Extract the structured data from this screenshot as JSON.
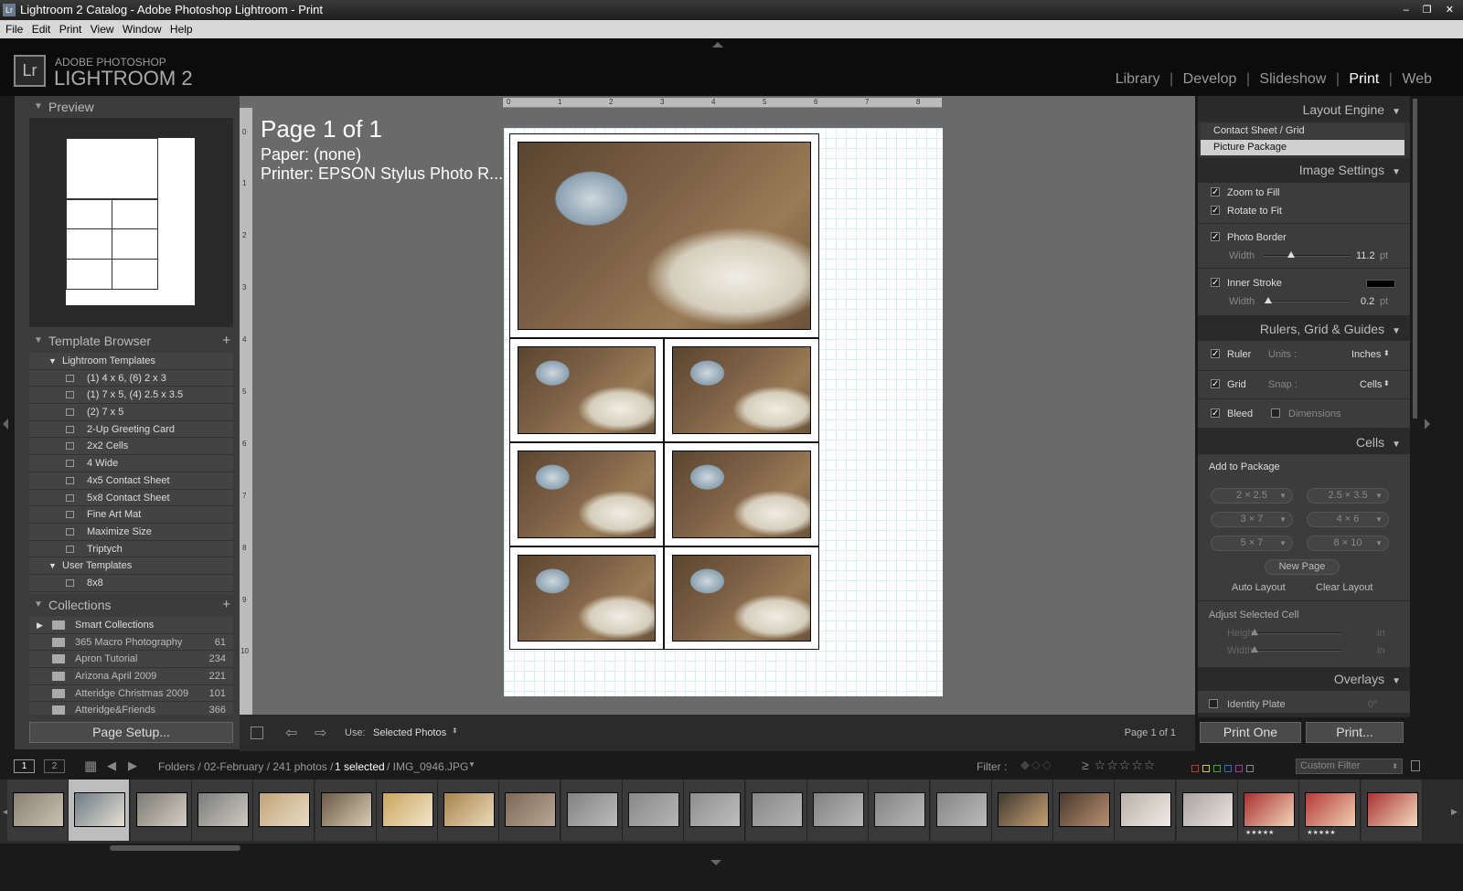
{
  "window": {
    "title": "Lightroom 2 Catalog - Adobe Photoshop Lightroom - Print",
    "app_icon": "Lr",
    "controls": "– ❐ ✕"
  },
  "menu": [
    "File",
    "Edit",
    "Print",
    "View",
    "Window",
    "Help"
  ],
  "identity": {
    "logo": "Lr",
    "brand_top": "ADOBE PHOTOSHOP",
    "brand_main": "LIGHTROOM 2"
  },
  "modules": [
    "Library",
    "Develop",
    "Slideshow",
    "Print",
    "Web"
  ],
  "left": {
    "preview_title": "Preview",
    "template_browser_title": "Template Browser",
    "lightroom_templates": "Lightroom Templates",
    "templates": [
      "(1) 4 x 6, (6) 2 x 3",
      "(1) 7 x 5, (4) 2.5 x 3.5",
      "(2) 7 x 5",
      "2-Up Greeting Card",
      "2x2 Cells",
      "4 Wide",
      "4x5 Contact Sheet",
      "5x8 Contact Sheet",
      "Fine Art Mat",
      "Maximize Size",
      "Triptych"
    ],
    "user_templates": "User Templates",
    "user_items": [
      "8x8"
    ],
    "collections_title": "Collections",
    "collections": [
      {
        "name": "Smart Collections",
        "count": ""
      },
      {
        "name": "365 Macro Photography",
        "count": "61"
      },
      {
        "name": "Apron Tutorial",
        "count": "234"
      },
      {
        "name": "Arizona April 2009",
        "count": "221"
      },
      {
        "name": "Atteridge Christmas 2009",
        "count": "101"
      },
      {
        "name": "Atteridge&Friends",
        "count": "366"
      }
    ],
    "page_setup": "Page Setup..."
  },
  "center": {
    "page": "Page 1 of 1",
    "paper": "Paper:  (none)",
    "printer": "Printer:  EPSON Stylus Photo R...",
    "ruler_ticks": [
      "0",
      "1",
      "2",
      "3",
      "4",
      "5",
      "6",
      "7",
      "8"
    ],
    "ruler_left_ticks": [
      "0",
      "1",
      "2",
      "3",
      "4",
      "5",
      "6",
      "7",
      "8",
      "9",
      "10"
    ]
  },
  "toolbar": {
    "use_label": "Use:",
    "use_value": "Selected Photos",
    "page_count": "Page 1 of 1"
  },
  "right": {
    "layout_engine": "Layout Engine",
    "engines": [
      "Contact Sheet / Grid",
      "Picture Package"
    ],
    "image_settings": "Image Settings",
    "zoom_to_fill": "Zoom to Fill",
    "rotate_to_fit": "Rotate to Fit",
    "photo_border": "Photo Border",
    "width_label": "Width",
    "border_width": "11.2",
    "unit_pt": "pt",
    "inner_stroke": "Inner Stroke",
    "stroke_width": "0.2",
    "rulers_title": "Rulers, Grid & Guides",
    "ruler": "Ruler",
    "units_label": "Units :",
    "units_value": "Inches",
    "grid": "Grid",
    "snap_label": "Snap :",
    "snap_value": "Cells",
    "bleed": "Bleed",
    "dimensions": "Dimensions",
    "cells_title": "Cells",
    "add_to_package": "Add to Package",
    "sizes": [
      "2 × 2.5",
      "2.5 × 3.5",
      "3 × 7",
      "4 × 6",
      "5 × 7",
      "8 × 10"
    ],
    "new_page": "New Page",
    "auto_layout": "Auto Layout",
    "clear_layout": "Clear Layout",
    "adjust_cell": "Adjust Selected Cell",
    "height_label": "Height",
    "in_unit": "in",
    "overlays_title": "Overlays",
    "identity_plate": "Identity Plate",
    "identity_deg": "0°",
    "print_one": "Print One",
    "print": "Print..."
  },
  "filmbar": {
    "views": [
      "1",
      "2"
    ],
    "path_prefix": "Folders / 02-February / 241 photos /",
    "selected": "1 selected",
    "file": "/ IMG_0946.JPG",
    "filter_label": "Filter :",
    "custom_filter": "Custom Filter"
  },
  "filmstrip": {
    "count": 23,
    "rated": "★★★★★"
  }
}
